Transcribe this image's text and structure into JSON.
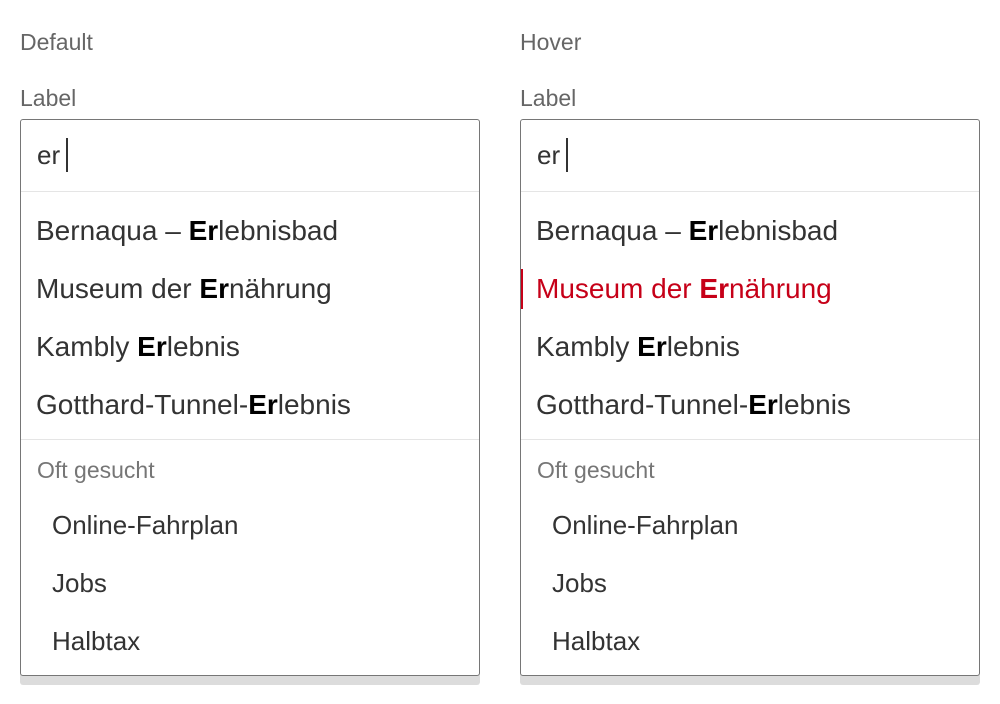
{
  "panels": [
    {
      "state_title": "Default",
      "label": "Label",
      "input_value": "er",
      "suggestions": [
        {
          "pre": "Bernaqua – ",
          "hl": "Er",
          "post": "lebnisbad"
        },
        {
          "pre": "Museum der ",
          "hl": "Er",
          "post": "nährung"
        },
        {
          "pre": "Kambly ",
          "hl": "Er",
          "post": "lebnis"
        },
        {
          "pre": "Gotthard-Tunnel-",
          "hl": "Er",
          "post": "lebnis"
        }
      ],
      "frequent_title": "Oft gesucht",
      "frequent": [
        "Online-Fahrplan",
        "Jobs",
        "Halbtax"
      ]
    },
    {
      "state_title": "Hover",
      "label": "Label",
      "input_value": "er",
      "suggestions": [
        {
          "pre": "Bernaqua – ",
          "hl": "Er",
          "post": "lebnisbad"
        },
        {
          "pre": "Museum der ",
          "hl": "Er",
          "post": "nährung"
        },
        {
          "pre": "Kambly ",
          "hl": "Er",
          "post": "lebnis"
        },
        {
          "pre": "Gotthard-Tunnel-",
          "hl": "Er",
          "post": "lebnis"
        }
      ],
      "frequent_title": "Oft gesucht",
      "frequent": [
        "Online-Fahrplan",
        "Jobs",
        "Halbtax"
      ]
    }
  ],
  "colors": {
    "accent_red": "#c60018",
    "text": "#333333",
    "muted": "#666666",
    "border": "#767676",
    "divider": "#e5e5e5"
  }
}
